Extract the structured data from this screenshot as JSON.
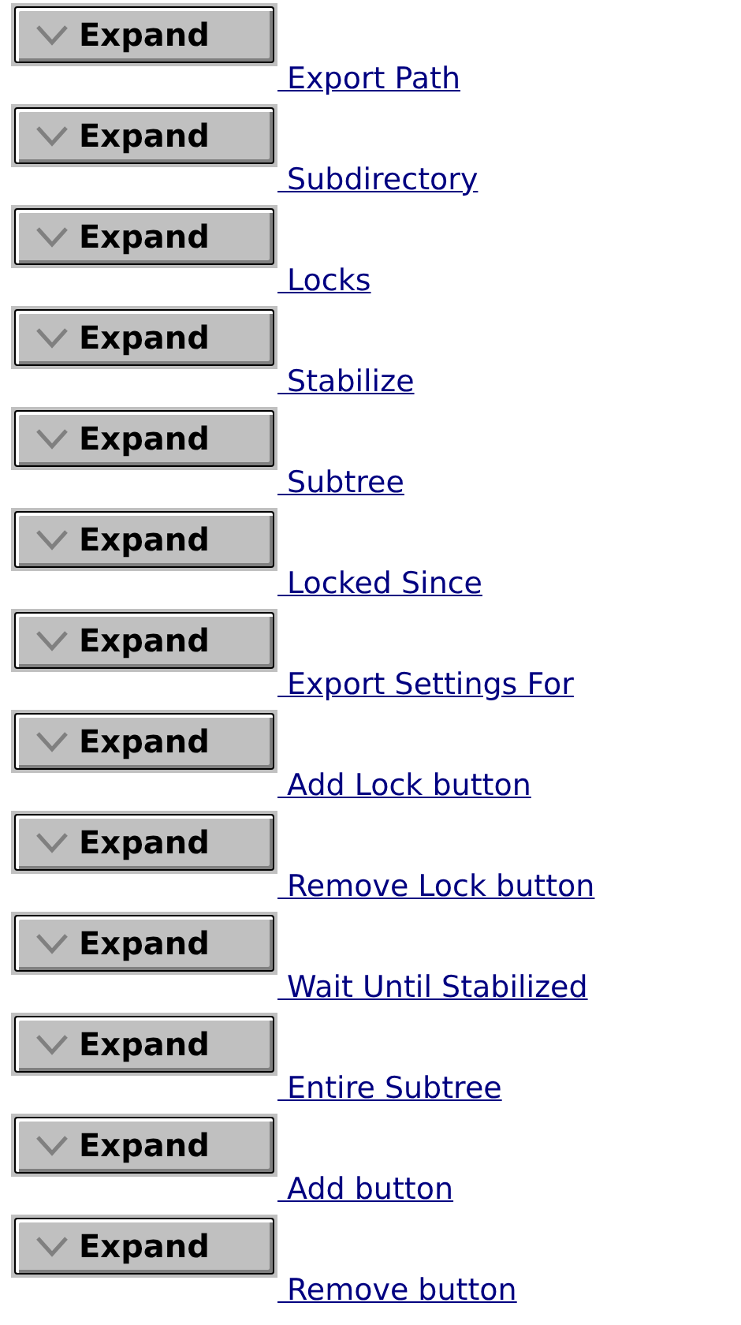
{
  "rows": [
    {
      "button": "Expand",
      "link": " Export Path"
    },
    {
      "button": "Expand",
      "link": " Subdirectory"
    },
    {
      "button": "Expand",
      "link": " Locks"
    },
    {
      "button": "Expand",
      "link": " Stabilize"
    },
    {
      "button": "Expand",
      "link": " Subtree"
    },
    {
      "button": "Expand",
      "link": " Locked Since"
    },
    {
      "button": "Expand",
      "link": " Export Settings For"
    },
    {
      "button": "Expand",
      "link": " Add Lock button"
    },
    {
      "button": "Expand",
      "link": " Remove Lock button"
    },
    {
      "button": "Expand",
      "link": " Wait Until Stabilized"
    },
    {
      "button": "Expand",
      "link": " Entire Subtree"
    },
    {
      "button": "Expand",
      "link": " Add button"
    },
    {
      "button": "Expand",
      "link": " Remove button"
    }
  ]
}
